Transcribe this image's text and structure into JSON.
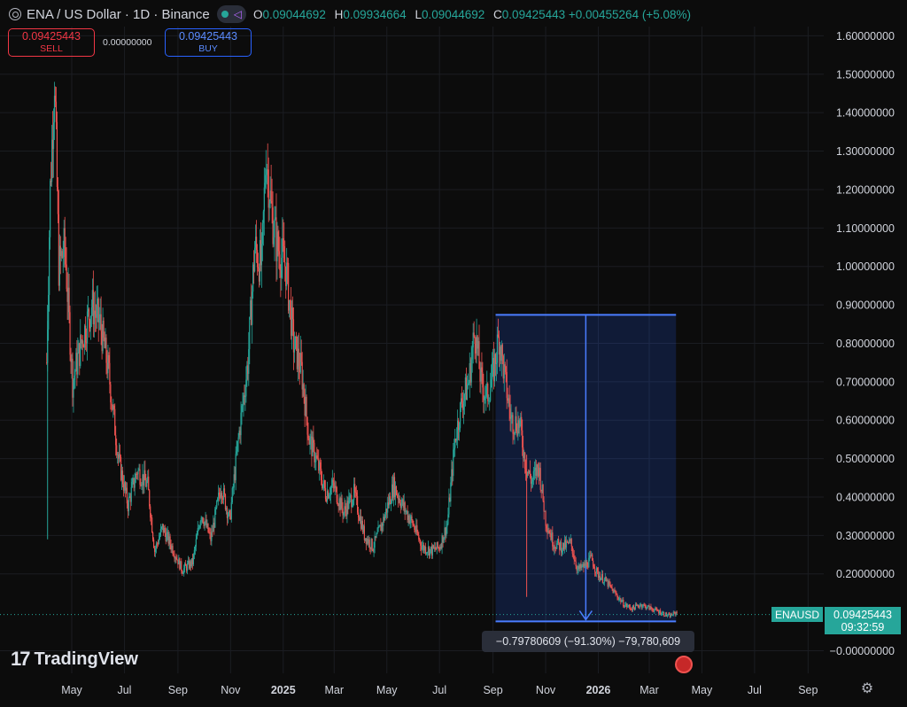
{
  "header": {
    "symbol_title": "ENA / US Dollar · 1D · Binance",
    "ohlc": [
      {
        "k": "O",
        "v": "0.09044692"
      },
      {
        "k": "H",
        "v": "0.09934664"
      },
      {
        "k": "L",
        "v": "0.09044692"
      },
      {
        "k": "C",
        "v": "0.09425443 +0.00455264 (+5.08%)"
      }
    ]
  },
  "trade": {
    "sell_price": "0.09425443",
    "sell_label": "SELL",
    "spread": "0.00000000",
    "buy_price": "0.09425443",
    "buy_label": "BUY"
  },
  "measure_label": "−0.79780609 (−91.30%) −79,780,609",
  "price_tag": {
    "symbol": "ENAUSD",
    "price": "0.09425443",
    "countdown": "09:32:59"
  },
  "logo_text": "TradingView",
  "colors": {
    "up": "#26a69a",
    "down": "#ef5350",
    "measure": "#2962ff",
    "bg": "#0c0c0c"
  },
  "icons": {
    "symbol": "coin-icon",
    "indicator": "dot-icon",
    "tools": "link-icon",
    "settings": "gear-icon",
    "event": "us-flag-icon"
  },
  "chart_data": {
    "type": "candlestick",
    "title": "ENA / US Dollar · 1D · Binance",
    "x_tick_labels": [
      "May",
      "Jul",
      "Sep",
      "Nov",
      "2025",
      "Mar",
      "May",
      "Jul",
      "Sep",
      "Nov",
      "2026",
      "Mar",
      "May",
      "Jul",
      "Sep"
    ],
    "y_tick_labels": [
      "1.60000000",
      "1.50000000",
      "1.40000000",
      "1.30000000",
      "1.20000000",
      "1.10000000",
      "1.00000000",
      "0.90000000",
      "0.80000000",
      "0.70000000",
      "0.60000000",
      "0.50000000",
      "0.40000000",
      "0.30000000",
      "0.20000000",
      "−0.00000000"
    ],
    "ylim": [
      -0.1,
      1.65
    ],
    "grid": true,
    "series": [
      {
        "name": "ENAUSD",
        "approx_close_path": [
          [
            "2024-04-02",
            0.75
          ],
          [
            "2024-04-06",
            1.2
          ],
          [
            "2024-04-11",
            1.5
          ],
          [
            "2024-04-16",
            1.0
          ],
          [
            "2024-04-23",
            1.05
          ],
          [
            "2024-05-02",
            0.7
          ],
          [
            "2024-05-12",
            0.8
          ],
          [
            "2024-05-24",
            0.9
          ],
          [
            "2024-06-03",
            0.85
          ],
          [
            "2024-06-13",
            0.72
          ],
          [
            "2024-06-24",
            0.5
          ],
          [
            "2024-07-05",
            0.38
          ],
          [
            "2024-07-16",
            0.47
          ],
          [
            "2024-07-28",
            0.43
          ],
          [
            "2024-08-05",
            0.26
          ],
          [
            "2024-08-14",
            0.32
          ],
          [
            "2024-08-25",
            0.27
          ],
          [
            "2024-09-06",
            0.21
          ],
          [
            "2024-09-18",
            0.23
          ],
          [
            "2024-09-28",
            0.36
          ],
          [
            "2024-10-09",
            0.29
          ],
          [
            "2024-10-21",
            0.43
          ],
          [
            "2024-10-31",
            0.34
          ],
          [
            "2024-11-10",
            0.55
          ],
          [
            "2024-11-21",
            0.75
          ],
          [
            "2024-11-29",
            1.05
          ],
          [
            "2024-12-07",
            1.0
          ],
          [
            "2024-12-12",
            1.3
          ],
          [
            "2024-12-18",
            1.15
          ],
          [
            "2024-12-25",
            1.05
          ],
          [
            "2025-01-04",
            1.0
          ],
          [
            "2025-01-13",
            0.8
          ],
          [
            "2025-01-22",
            0.73
          ],
          [
            "2025-01-31",
            0.55
          ],
          [
            "2025-02-08",
            0.5
          ],
          [
            "2025-02-19",
            0.41
          ],
          [
            "2025-02-28",
            0.43
          ],
          [
            "2025-03-12",
            0.36
          ],
          [
            "2025-03-24",
            0.41
          ],
          [
            "2025-04-05",
            0.3
          ],
          [
            "2025-04-15",
            0.27
          ],
          [
            "2025-04-27",
            0.34
          ],
          [
            "2025-05-09",
            0.43
          ],
          [
            "2025-05-19",
            0.38
          ],
          [
            "2025-05-31",
            0.33
          ],
          [
            "2025-06-11",
            0.27
          ],
          [
            "2025-06-22",
            0.26
          ],
          [
            "2025-07-01",
            0.27
          ],
          [
            "2025-07-10",
            0.33
          ],
          [
            "2025-07-19",
            0.55
          ],
          [
            "2025-07-27",
            0.65
          ],
          [
            "2025-08-04",
            0.7
          ],
          [
            "2025-08-11",
            0.84
          ],
          [
            "2025-08-18",
            0.7
          ],
          [
            "2025-08-25",
            0.66
          ],
          [
            "2025-09-01",
            0.72
          ],
          [
            "2025-09-08",
            0.82
          ],
          [
            "2025-09-14",
            0.72
          ],
          [
            "2025-09-22",
            0.6
          ],
          [
            "2025-10-02",
            0.59
          ],
          [
            "2025-10-09",
            0.48
          ],
          [
            "2025-10-16",
            0.44
          ],
          [
            "2025-10-24",
            0.48
          ],
          [
            "2025-11-01",
            0.34
          ],
          [
            "2025-11-10",
            0.28
          ],
          [
            "2025-11-21",
            0.27
          ],
          [
            "2025-11-30",
            0.28
          ],
          [
            "2025-12-08",
            0.21
          ],
          [
            "2025-12-16",
            0.22
          ],
          [
            "2025-12-24",
            0.24
          ],
          [
            "2025-12-31",
            0.2
          ],
          [
            "2026-01-10",
            0.18
          ],
          [
            "2026-01-20",
            0.15
          ],
          [
            "2026-01-31",
            0.12
          ],
          [
            "2026-02-09",
            0.11
          ],
          [
            "2026-02-19",
            0.12
          ],
          [
            "2026-03-03",
            0.11
          ],
          [
            "2026-03-14",
            0.1
          ],
          [
            "2026-03-24",
            0.09
          ],
          [
            "2026-04-02",
            0.1
          ]
        ]
      }
    ],
    "measure_rect": {
      "from_date": "2025-09-04",
      "to_date": "2026-04-01",
      "high": 0.874,
      "low": 0.0763
    },
    "last_price": 0.09425443
  }
}
